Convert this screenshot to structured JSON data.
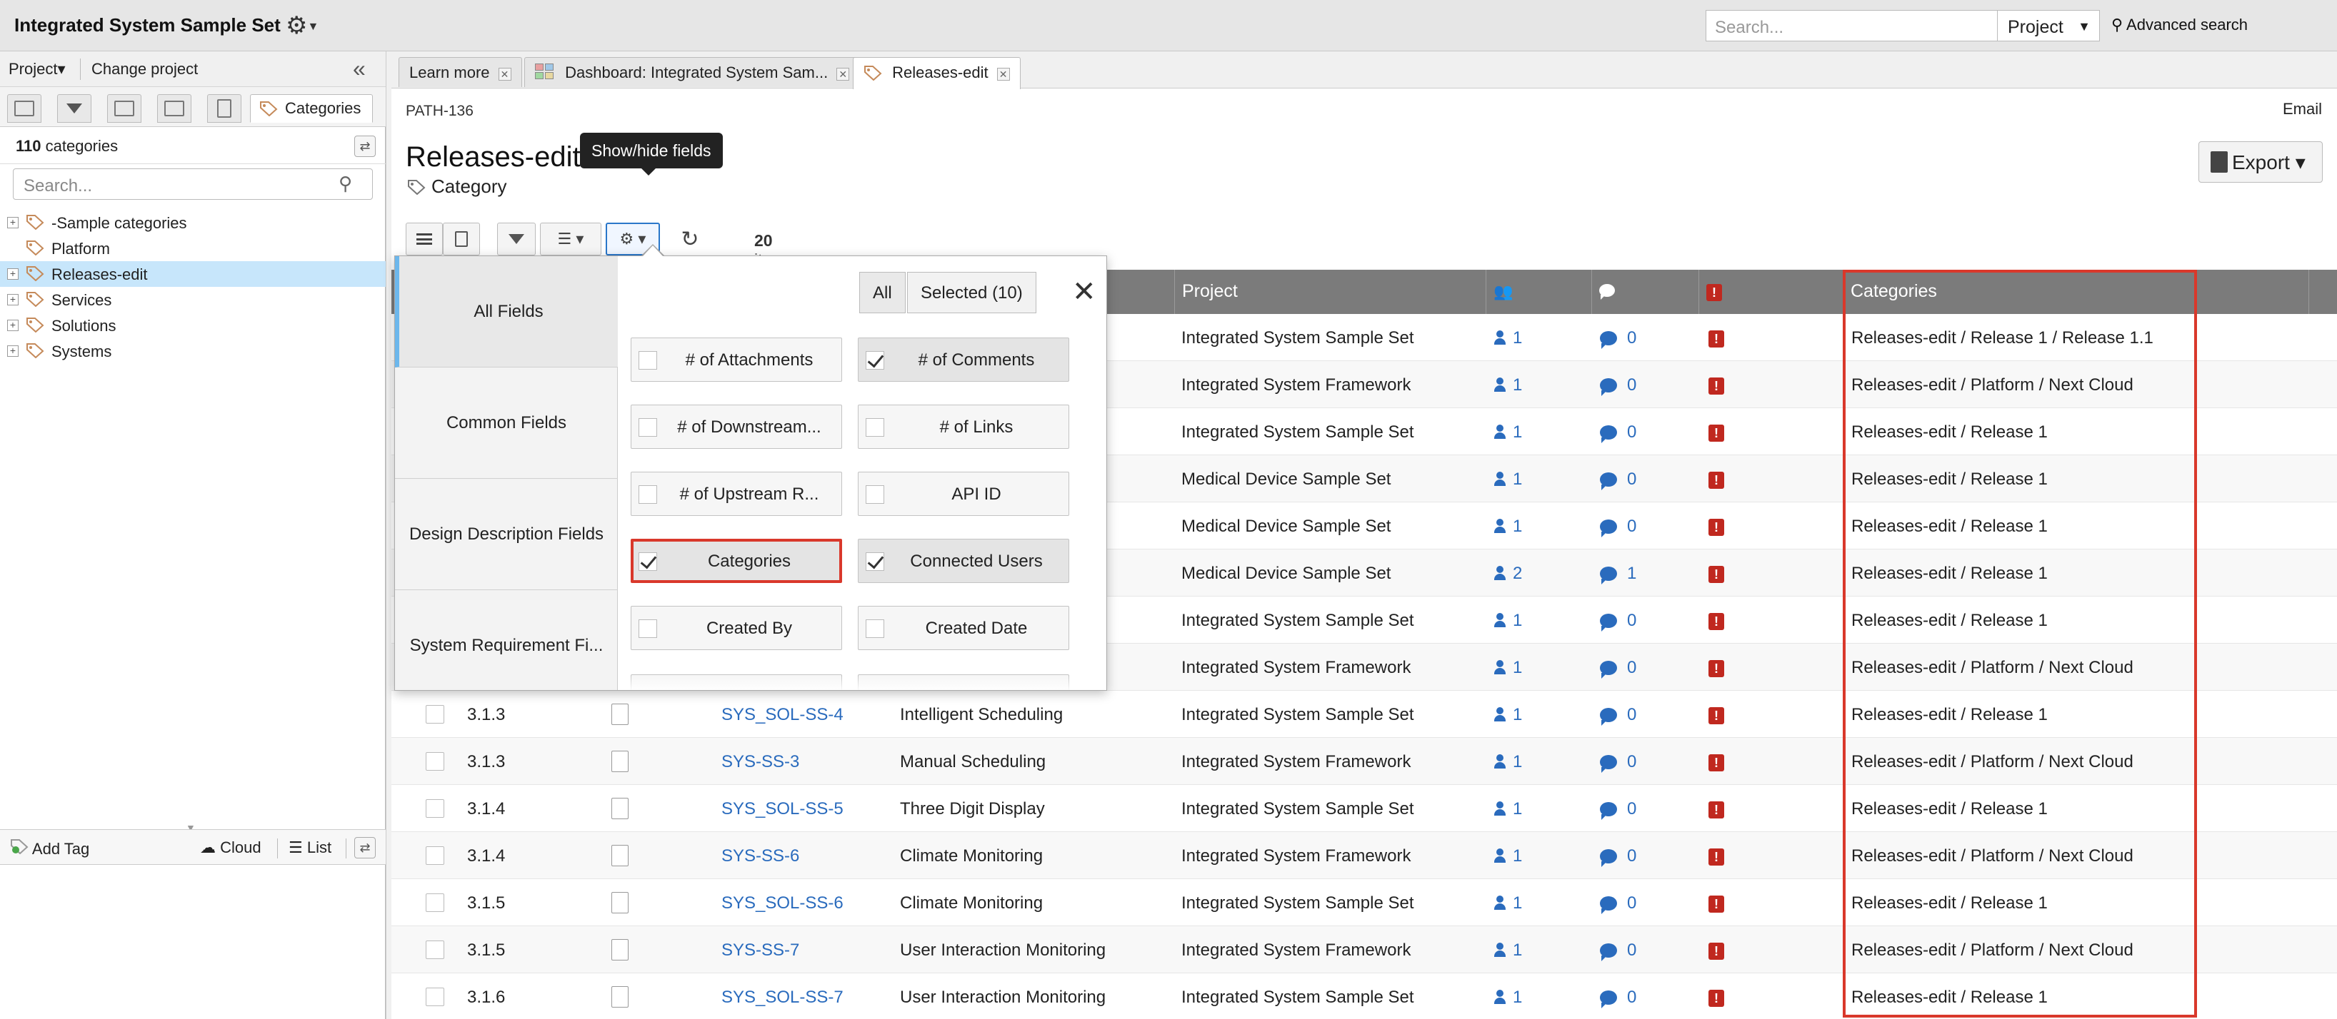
{
  "app": {
    "title": "Integrated System Sample Set",
    "search_placeholder": "Search...",
    "project_select": "Project",
    "advanced_search": "Advanced search"
  },
  "left_panel": {
    "project_menu": "Project▾",
    "change_project": "Change project",
    "active_tab": "Categories",
    "count_number": "110",
    "count_label": "categories",
    "search_placeholder": "Search...",
    "tree": [
      {
        "label": "-Sample categories",
        "expandable": true
      },
      {
        "label": "Platform",
        "expandable": false
      },
      {
        "label": "Releases-edit",
        "expandable": true,
        "selected": true
      },
      {
        "label": "Services",
        "expandable": true
      },
      {
        "label": "Solutions",
        "expandable": true
      },
      {
        "label": "Systems",
        "expandable": true
      }
    ],
    "add_tag": "Add Tag",
    "cloud": "Cloud",
    "list": "List"
  },
  "tabs": [
    {
      "label": "Learn more"
    },
    {
      "label": "Dashboard: Integrated System Sam..."
    },
    {
      "label": "Releases-edit",
      "active": true
    }
  ],
  "page": {
    "path_id": "PATH-136",
    "email": "Email",
    "title": "Releases-edit",
    "subtitle": "Category",
    "export": "Export",
    "tooltip": "Show/hide fields",
    "item_count": "20",
    "item_count_label": "items"
  },
  "table": {
    "headers": {
      "project": "Project",
      "categories": "Categories"
    },
    "rows": [
      {
        "num": "",
        "id": "",
        "name": "",
        "project": "Integrated System Sample Set",
        "users": "1",
        "comments": "0",
        "categories": "Releases-edit / Release 1 / Release 1.1"
      },
      {
        "num": "",
        "id": "",
        "name": "",
        "project": "Integrated System Framework",
        "users": "1",
        "comments": "0",
        "categories": "Releases-edit / Platform / Next Cloud"
      },
      {
        "num": "",
        "id": "",
        "name": "",
        "project": "Integrated System Sample Set",
        "users": "1",
        "comments": "0",
        "categories": "Releases-edit / Release 1"
      },
      {
        "num": "",
        "id": "",
        "name": "",
        "project": "Medical Device Sample Set",
        "users": "1",
        "comments": "0",
        "categories": "Releases-edit / Release 1"
      },
      {
        "num": "",
        "id": "",
        "name": "",
        "project": "Medical Device Sample Set",
        "users": "1",
        "comments": "0",
        "categories": "Releases-edit / Release 1"
      },
      {
        "num": "",
        "id": "",
        "name": "",
        "project": "Medical Device Sample Set",
        "users": "2",
        "comments": "1",
        "categories": "Releases-edit / Release 1"
      },
      {
        "num": "",
        "id": "",
        "name": "",
        "project": "Integrated System Sample Set",
        "users": "1",
        "comments": "0",
        "categories": "Releases-edit / Release 1"
      },
      {
        "num": "",
        "id": "",
        "name": "",
        "project": "Integrated System Framework",
        "users": "1",
        "comments": "0",
        "categories": "Releases-edit / Platform / Next Cloud"
      },
      {
        "num": "3.1.3",
        "id": "SYS_SOL-SS-4",
        "name": "Intelligent Scheduling",
        "project": "Integrated System Sample Set",
        "users": "1",
        "comments": "0",
        "categories": "Releases-edit / Release 1"
      },
      {
        "num": "3.1.3",
        "id": "SYS-SS-3",
        "name": "Manual Scheduling",
        "project": "Integrated System Framework",
        "users": "1",
        "comments": "0",
        "categories": "Releases-edit / Platform / Next Cloud"
      },
      {
        "num": "3.1.4",
        "id": "SYS_SOL-SS-5",
        "name": "Three Digit Display",
        "project": "Integrated System Sample Set",
        "users": "1",
        "comments": "0",
        "categories": "Releases-edit / Release 1"
      },
      {
        "num": "3.1.4",
        "id": "SYS-SS-6",
        "name": "Climate Monitoring",
        "project": "Integrated System Framework",
        "users": "1",
        "comments": "0",
        "categories": "Releases-edit / Platform / Next Cloud"
      },
      {
        "num": "3.1.5",
        "id": "SYS_SOL-SS-6",
        "name": "Climate Monitoring",
        "project": "Integrated System Sample Set",
        "users": "1",
        "comments": "0",
        "categories": "Releases-edit / Release 1"
      },
      {
        "num": "3.1.5",
        "id": "SYS-SS-7",
        "name": "User Interaction Monitoring",
        "project": "Integrated System Framework",
        "users": "1",
        "comments": "0",
        "categories": "Releases-edit / Platform / Next Cloud"
      },
      {
        "num": "3.1.6",
        "id": "SYS_SOL-SS-7",
        "name": "User Interaction Monitoring",
        "project": "Integrated System Sample Set",
        "users": "1",
        "comments": "0",
        "categories": "Releases-edit / Release 1"
      }
    ]
  },
  "fields_popup": {
    "categories": [
      "All Fields",
      "Common Fields",
      "Design Description Fields",
      "System Requirement Fi..."
    ],
    "all_button": "All",
    "selected_button": "Selected (10)",
    "fields": [
      {
        "label": "# of Attachments",
        "checked": false
      },
      {
        "label": "# of Comments",
        "checked": true
      },
      {
        "label": "# of Downstream...",
        "checked": false
      },
      {
        "label": "# of Links",
        "checked": false
      },
      {
        "label": "# of Upstream R...",
        "checked": false
      },
      {
        "label": "API ID",
        "checked": false
      },
      {
        "label": "Categories",
        "checked": true,
        "highlighted": true
      },
      {
        "label": "Connected Users",
        "checked": true
      },
      {
        "label": "Created By",
        "checked": false
      },
      {
        "label": "Created Date",
        "checked": false
      }
    ]
  },
  "colors": {
    "accent_blue": "#2a6bbd",
    "highlight_red": "#d9382b",
    "header_gray": "#7b7b7b",
    "selected_tree": "#c7e6fb"
  }
}
